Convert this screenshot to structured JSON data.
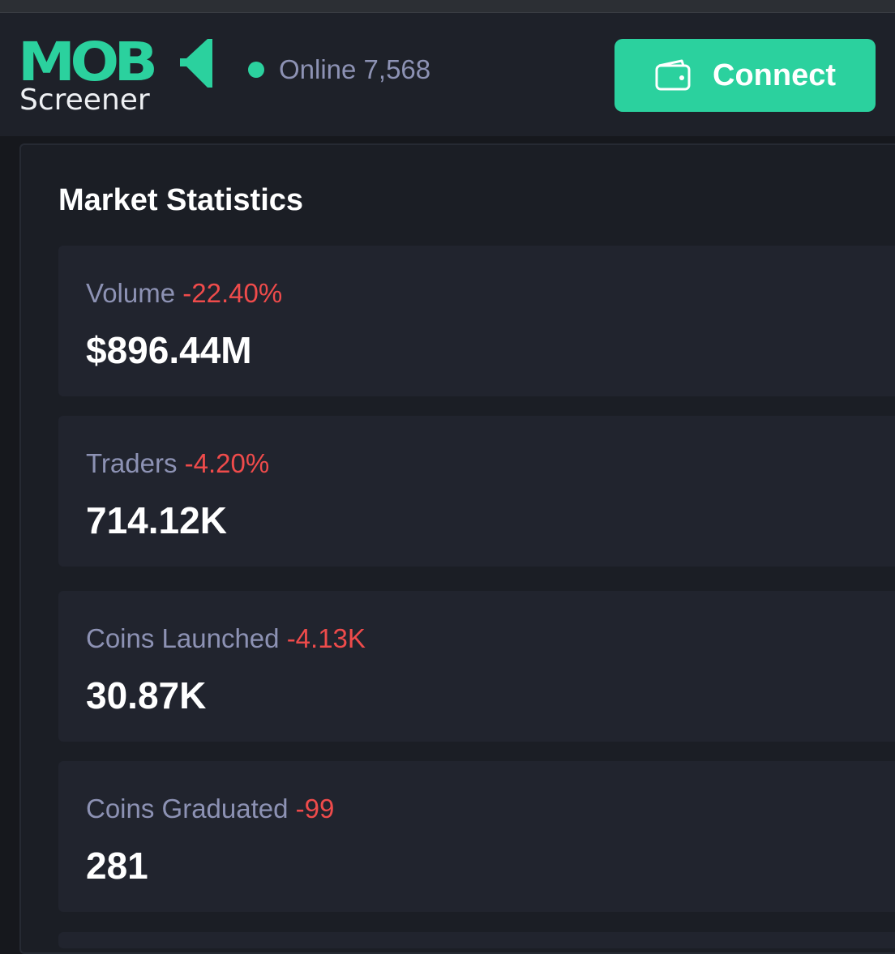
{
  "header": {
    "logo_word": "MOB",
    "logo_sub": "Screener",
    "online_label": "Online 7,568",
    "connect_label": "Connect"
  },
  "colors": {
    "accent": "#2bd19e",
    "negative": "#ef4b4b",
    "muted_text": "#8d92b4",
    "background": "#16181d",
    "card": "#21242e"
  },
  "icons": {
    "online": "status-dot-icon",
    "connect": "wallet-icon",
    "logo_mark": "logo-arrow-mark-icon"
  },
  "market": {
    "title": "Market Statistics",
    "stats": [
      {
        "label": "Volume",
        "change": "-22.40%",
        "value": "$896.44M"
      },
      {
        "label": "Traders",
        "change": "-4.20%",
        "value": "714.12K"
      },
      {
        "label": "Coins Launched",
        "change": "-4.13K",
        "value": "30.87K"
      },
      {
        "label": "Coins Graduated",
        "change": "-99",
        "value": "281"
      }
    ]
  }
}
